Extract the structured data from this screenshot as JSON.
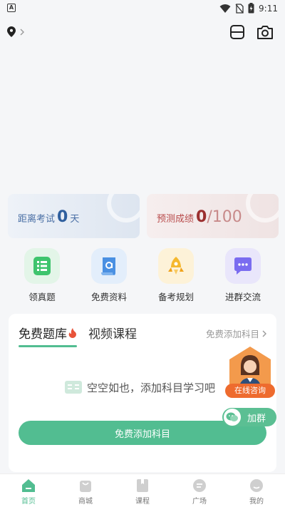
{
  "status_bar": {
    "time": "9:11"
  },
  "stats": {
    "exam_label": "距离考试",
    "exam_days": "0",
    "exam_unit": "天",
    "score_label": "预测成绩",
    "score_value": "0",
    "score_total": "/100"
  },
  "quick_actions": [
    {
      "label": "领真题",
      "icon": "exam-paper-icon",
      "color": "#3ec46d"
    },
    {
      "label": "免费资料",
      "icon": "document-icon",
      "color": "#4a90e2"
    },
    {
      "label": "备考规划",
      "icon": "rocket-icon",
      "color": "#f5b82e"
    },
    {
      "label": "进群交流",
      "icon": "chat-group-icon",
      "color": "#7a6cf0"
    }
  ],
  "panel": {
    "tab_questions": "免费题库",
    "tab_courses": "视频课程",
    "add_subject_link": "免费添加科目",
    "empty_text": "空空如也，添加科目学习吧",
    "add_button": "免费添加科目"
  },
  "floating": {
    "consult_label": "在线咨询",
    "join_label": "加群"
  },
  "tab_bar": [
    {
      "label": "首页",
      "icon": "home-icon",
      "active": true
    },
    {
      "label": "商城",
      "icon": "shop-bag-icon",
      "active": false
    },
    {
      "label": "课程",
      "icon": "book-icon",
      "active": false
    },
    {
      "label": "广场",
      "icon": "square-chat-icon",
      "active": false
    },
    {
      "label": "我的",
      "icon": "profile-icon",
      "active": false
    }
  ],
  "colors": {
    "accent": "#52bd91",
    "consult": "#ee6b2e"
  }
}
